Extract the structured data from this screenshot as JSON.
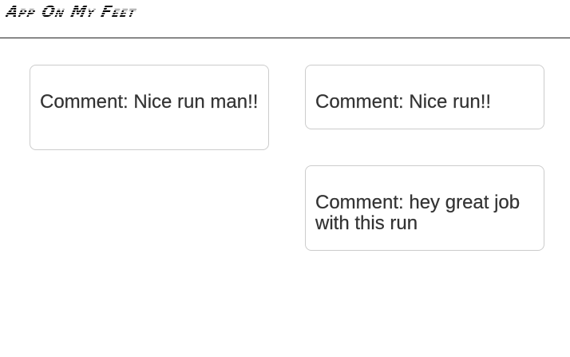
{
  "header": {
    "logo_text": "App On My Feet"
  },
  "comments": [
    {
      "text": "Comment: Nice run man!!"
    },
    {
      "text": "Comment: Nice run!!"
    },
    {
      "text": "Comment: hey great job with this run"
    }
  ]
}
